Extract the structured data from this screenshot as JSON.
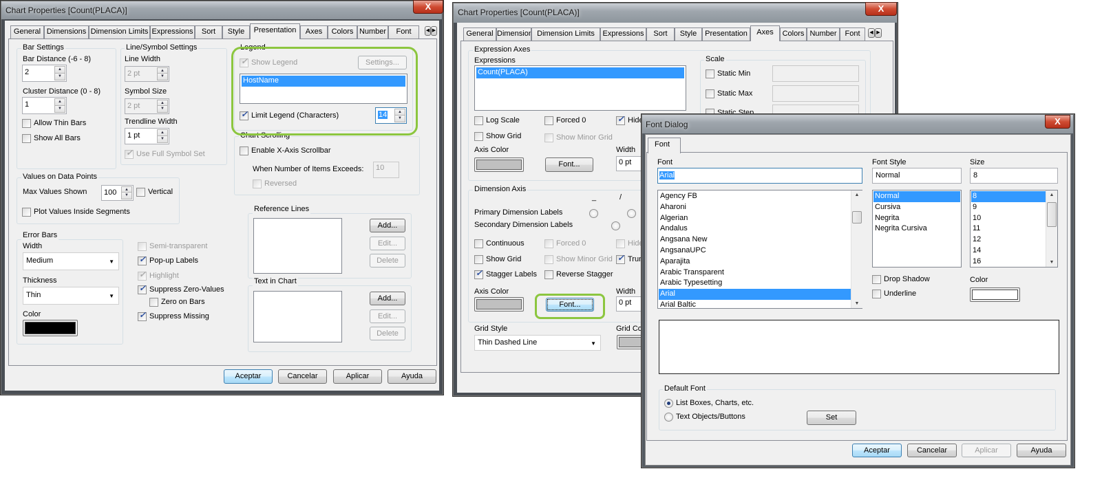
{
  "d1": {
    "title": "Chart Properties [Count(PLACA)]",
    "close": "X",
    "tabs": [
      "General",
      "Dimensions",
      "Dimension Limits",
      "Expressions",
      "Sort",
      "Style",
      "Presentation",
      "Axes",
      "Colors",
      "Number",
      "Font"
    ],
    "active_tab": "Presentation",
    "bar_settings": {
      "title": "Bar Settings",
      "bar_distance_label": "Bar Distance (-6 - 8)",
      "bar_distance": "2",
      "cluster_label": "Cluster Distance (0 - 8)",
      "cluster": "1",
      "allow_thin": "Allow Thin Bars",
      "show_all": "Show All Bars"
    },
    "line_symbol": {
      "title": "Line/Symbol Settings",
      "line_width_label": "Line Width",
      "line_width": "2 pt",
      "symbol_size_label": "Symbol Size",
      "symbol_size": "2 pt",
      "trendline_label": "Trendline Width",
      "trendline": "1 pt",
      "full_symbol": "Use Full Symbol Set"
    },
    "legend": {
      "title": "Legend",
      "show_legend": "Show Legend",
      "settings": "Settings...",
      "items": [
        "HostName"
      ],
      "limit": "Limit Legend (Characters)",
      "limit_value": "14"
    },
    "scrolling": {
      "title": "Chart Scrolling",
      "enable": "Enable X-Axis Scrollbar",
      "exceeds_label": "When Number of Items Exceeds:",
      "exceeds_value": "10",
      "reversed": "Reversed"
    },
    "values": {
      "title": "Values on Data Points",
      "max_label": "Max Values Shown",
      "max": "100",
      "vertical": "Vertical",
      "inside": "Plot Values Inside Segments"
    },
    "ref": {
      "title": "Reference Lines",
      "add": "Add...",
      "edit": "Edit...",
      "delete": "Delete"
    },
    "error": {
      "title": "Error Bars",
      "width_label": "Width",
      "width": "Medium",
      "thickness_label": "Thickness",
      "thickness": "Thin",
      "color_label": "Color",
      "color": "#000000"
    },
    "opts": {
      "semi": "Semi-transparent",
      "popup": "Pop-up Labels",
      "highlight": "Highlight",
      "suppress_zero": "Suppress Zero-Values",
      "zero_bars": "Zero on Bars",
      "suppress_missing": "Suppress Missing"
    },
    "checked": {
      "show_legend": true,
      "limit": true,
      "full_symbol": true,
      "popup": true,
      "highlight": true,
      "suppress_zero": true,
      "suppress_missing": true
    },
    "text_chart": {
      "title": "Text in Chart",
      "add": "Add...",
      "edit": "Edit...",
      "delete": "Delete"
    },
    "footer": {
      "ok": "Aceptar",
      "cancel": "Cancelar",
      "apply": "Aplicar",
      "help": "Ayuda"
    }
  },
  "d2": {
    "title": "Chart Properties [Count(PLACA)]",
    "tabs": [
      "General",
      "Dimensions",
      "Dimension Limits",
      "Expressions",
      "Sort",
      "Style",
      "Presentation",
      "Axes",
      "Colors",
      "Number",
      "Font"
    ],
    "active_tab": "Axes",
    "expr_axes": {
      "title": "Expression Axes",
      "expressions_label": "Expressions",
      "expressions": [
        "Count(PLACA)"
      ],
      "log_scale": "Log Scale",
      "forced0": "Forced 0",
      "hide": "Hide",
      "show_grid": "Show Grid",
      "show_minor": "Show Minor Grid",
      "axis_color": "Axis Color",
      "axis_color_value": "#c0c0c0",
      "font": "Font...",
      "width_label": "Width",
      "width": "0 pt"
    },
    "scale": {
      "title": "Scale",
      "static_min": "Static Min",
      "static_max": "Static Max",
      "static_step": "Static Step"
    },
    "dim_axis": {
      "title": "Dimension Axis",
      "col1": "_",
      "col2": "/",
      "primary": "Primary Dimension Labels",
      "secondary": "Secondary Dimension Labels",
      "continuous": "Continuous",
      "forced0": "Forced 0",
      "hide": "Hide",
      "show_grid": "Show Grid",
      "show_minor": "Show Minor Grid",
      "truncate": "Trun",
      "stagger": "Stagger Labels",
      "reverse": "Reverse Stagger",
      "axis_color": "Axis Color",
      "axis_color_value": "#c0c0c0",
      "font": "Font...",
      "width_label": "Width",
      "width": "0 pt"
    },
    "grid_style_label": "Grid Style",
    "grid_style": "Thin Dashed Line",
    "grid_color_label": "Grid Col",
    "checked": {
      "hide": true,
      "truncate": true,
      "stagger": true
    }
  },
  "d3": {
    "title": "Font Dialog",
    "close": "X",
    "tab": "Font",
    "font_label": "Font",
    "font_value": "Arial",
    "fonts": [
      "Agency FB",
      "Aharoni",
      "Algerian",
      "Andalus",
      "Angsana New",
      "AngsanaUPC",
      "Aparajita",
      "Arabic Transparent",
      "Arabic Typesetting",
      "Arial",
      "Arial Baltic"
    ],
    "selected_font": "Arial",
    "style_label": "Font Style",
    "style_value": "Normal",
    "styles": [
      "Normal",
      "Cursiva",
      "Negrita",
      "Negrita Cursiva"
    ],
    "size_label": "Size",
    "size_value": "8",
    "sizes": [
      "8",
      "9",
      "10",
      "11",
      "12",
      "14",
      "16"
    ],
    "drop_shadow": "Drop Shadow",
    "underline": "Underline",
    "color_label": "Color",
    "color": "#ffffff",
    "default_font": {
      "title": "Default Font",
      "opt1": "List Boxes, Charts, etc.",
      "opt2": "Text Objects/Buttons",
      "selected": "List Boxes, Charts, etc.",
      "set": "Set"
    },
    "footer": {
      "ok": "Aceptar",
      "cancel": "Cancelar",
      "apply": "Aplicar",
      "help": "Ayuda"
    }
  }
}
